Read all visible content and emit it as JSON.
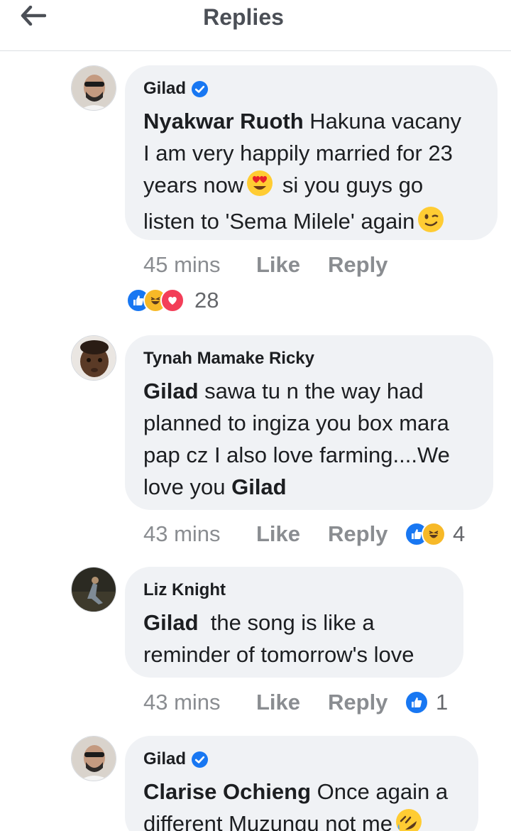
{
  "header": {
    "title": "Replies",
    "back_icon": "arrow-left-icon"
  },
  "comments": [
    {
      "author": "Gilad",
      "verified": true,
      "mention": "Nyakwar Ruoth",
      "lines": [
        "Hakuna vacany",
        "I am very happily married for 23",
        "years now",
        "si you guys go",
        "listen to 'Sema Milele' again"
      ],
      "time": "45 mins",
      "like": "Like",
      "reply": "Reply",
      "reactions": [
        "like",
        "haha",
        "love"
      ],
      "reaction_count": "28"
    },
    {
      "author": "Tynah Mamake Ricky",
      "verified": false,
      "mention": "Gilad",
      "lines": [
        "sawa tu n the way had",
        "planned to ingiza you box mara",
        "pap cz I also love farming....We",
        "love you"
      ],
      "mention_end": "Gilad",
      "time": "43 mins",
      "like": "Like",
      "reply": "Reply",
      "reactions": [
        "like",
        "haha"
      ],
      "reaction_count": "4"
    },
    {
      "author": "Liz Knight",
      "verified": false,
      "mention": "Gilad",
      "lines": [
        "the song is like a",
        "reminder of tomorrow's love"
      ],
      "time": "43 mins",
      "like": "Like",
      "reply": "Reply",
      "reactions": [
        "like"
      ],
      "reaction_count": "1"
    },
    {
      "author": "Gilad",
      "verified": true,
      "mention": "Clarise Ochieng",
      "lines": [
        "Once again a",
        "different Muzungu not me"
      ]
    }
  ],
  "colors": {
    "bubble": "#f0f2f5",
    "like_blue": "#1877f2",
    "meta_gray": "#8a8d91",
    "love_red": "#f33e58",
    "haha_yellow": "#f7b928"
  }
}
